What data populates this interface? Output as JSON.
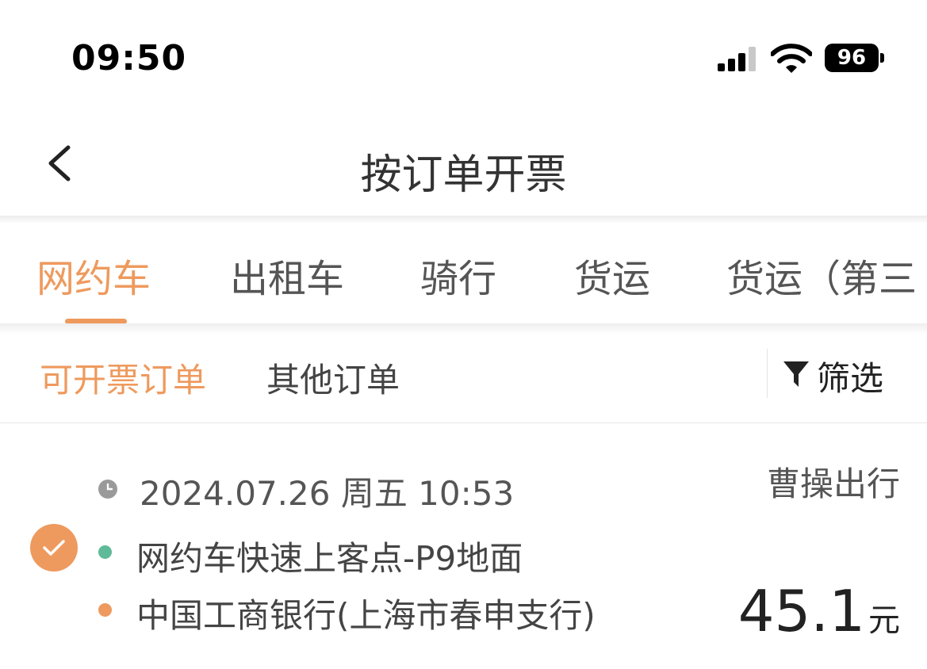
{
  "status_bar": {
    "time": "09:50",
    "battery": "96",
    "icons": [
      "signal-icon",
      "wifi-icon",
      "battery-icon"
    ]
  },
  "nav": {
    "title": "按订单开票",
    "back_icon": "chevron-left-icon"
  },
  "tabs": [
    {
      "label": "网约车",
      "active": true
    },
    {
      "label": "出租车",
      "active": false
    },
    {
      "label": "骑行",
      "active": false
    },
    {
      "label": "货运",
      "active": false
    },
    {
      "label": "货运（第三",
      "active": false
    }
  ],
  "subtabs": [
    {
      "label": "可开票订单",
      "active": true
    },
    {
      "label": "其他订单",
      "active": false
    }
  ],
  "filter": {
    "label": "筛选",
    "icon": "funnel-icon"
  },
  "order": {
    "selected": true,
    "time": "2024.07.26 周五 10:53",
    "provider": "曹操出行",
    "start": "网约车快速上客点-P9地面",
    "end": "中国工商银行(上海市春申支行)",
    "price": "45.1",
    "unit": "元"
  },
  "colors": {
    "accent": "#ee9a5e",
    "start_dot": "#5fba9a",
    "end_dot": "#ee9a5e"
  }
}
